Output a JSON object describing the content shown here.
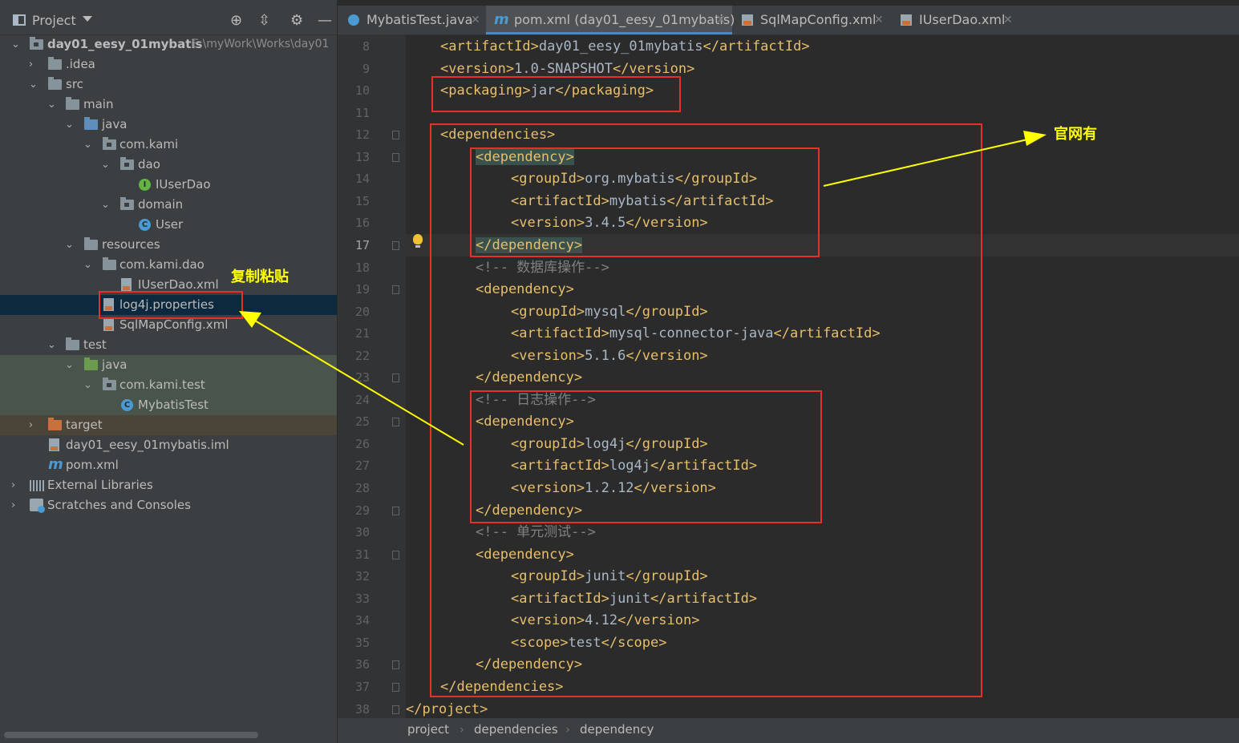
{
  "project_panel": {
    "title": "Project",
    "tree": [
      {
        "label": "day01_eesy_01mybatis",
        "path_hint": "E:\\myWork\\Works\\day01"
      },
      {
        "label": ".idea"
      },
      {
        "label": "src"
      },
      {
        "label": "main"
      },
      {
        "label": "java"
      },
      {
        "label": "com.kami"
      },
      {
        "label": "dao"
      },
      {
        "label": "IUserDao"
      },
      {
        "label": "domain"
      },
      {
        "label": "User"
      },
      {
        "label": "resources"
      },
      {
        "label": "com.kami.dao"
      },
      {
        "label": "IUserDao.xml"
      },
      {
        "label": "log4j.properties"
      },
      {
        "label": "SqlMapConfig.xml"
      },
      {
        "label": "test"
      },
      {
        "label": "java"
      },
      {
        "label": "com.kami.test"
      },
      {
        "label": "MybatisTest"
      },
      {
        "label": "target"
      },
      {
        "label": "day01_eesy_01mybatis.iml"
      },
      {
        "label": "pom.xml"
      },
      {
        "label": "External Libraries"
      },
      {
        "label": "Scratches and Consoles"
      }
    ]
  },
  "tabs": [
    {
      "label": "MybatisTest.java"
    },
    {
      "label": "pom.xml (day01_eesy_01mybatis)"
    },
    {
      "label": "SqlMapConfig.xml"
    },
    {
      "label": "IUserDao.xml"
    }
  ],
  "editor": {
    "line_numbers": [
      "8",
      "9",
      "10",
      "11",
      "12",
      "13",
      "14",
      "15",
      "16",
      "17",
      "18",
      "19",
      "20",
      "21",
      "22",
      "23",
      "24",
      "25",
      "26",
      "27",
      "28",
      "29",
      "30",
      "31",
      "32",
      "33",
      "34",
      "35",
      "36",
      "37",
      "38"
    ],
    "lines": [
      {
        "indent": 1,
        "open": "<artifactId>",
        "value": "day01_eesy_01mybatis",
        "close": "</artifactId>"
      },
      {
        "indent": 1,
        "open": "<version>",
        "value": "1.0-SNAPSHOT",
        "close": "</version>"
      },
      {
        "indent": 1,
        "open": "<packaging>",
        "value": "jar",
        "close": "</packaging>"
      },
      {
        "indent": 0,
        "open": "",
        "value": "",
        "close": ""
      },
      {
        "indent": 1,
        "open": "<dependencies>",
        "value": "",
        "close": ""
      },
      {
        "indent": 2,
        "open": "<dependency>",
        "value": "",
        "close": ""
      },
      {
        "indent": 3,
        "open": "<groupId>",
        "value": "org.mybatis",
        "close": "</groupId>"
      },
      {
        "indent": 3,
        "open": "<artifactId>",
        "value": "mybatis",
        "close": "</artifactId>"
      },
      {
        "indent": 3,
        "open": "<version>",
        "value": "3.4.5",
        "close": "</version>"
      },
      {
        "indent": 2,
        "open": "</dependency>",
        "value": "",
        "close": ""
      },
      {
        "indent": 2,
        "comment": "<!-- 数据库操作-->"
      },
      {
        "indent": 2,
        "open": "<dependency>",
        "value": "",
        "close": ""
      },
      {
        "indent": 3,
        "open": "<groupId>",
        "value": "mysql",
        "close": "</groupId>"
      },
      {
        "indent": 3,
        "open": "<artifactId>",
        "value": "mysql-connector-java",
        "close": "</artifactId>"
      },
      {
        "indent": 3,
        "open": "<version>",
        "value": "5.1.6",
        "close": "</version>"
      },
      {
        "indent": 2,
        "open": "</dependency>",
        "value": "",
        "close": ""
      },
      {
        "indent": 2,
        "comment": "<!-- 日志操作-->"
      },
      {
        "indent": 2,
        "open": "<dependency>",
        "value": "",
        "close": ""
      },
      {
        "indent": 3,
        "open": "<groupId>",
        "value": "log4j",
        "close": "</groupId>"
      },
      {
        "indent": 3,
        "open": "<artifactId>",
        "value": "log4j",
        "close": "</artifactId>"
      },
      {
        "indent": 3,
        "open": "<version>",
        "value": "1.2.12",
        "close": "</version>"
      },
      {
        "indent": 2,
        "open": "</dependency>",
        "value": "",
        "close": ""
      },
      {
        "indent": 2,
        "comment": "<!-- 单元测试-->"
      },
      {
        "indent": 2,
        "open": "<dependency>",
        "value": "",
        "close": ""
      },
      {
        "indent": 3,
        "open": "<groupId>",
        "value": "junit",
        "close": "</groupId>"
      },
      {
        "indent": 3,
        "open": "<artifactId>",
        "value": "junit",
        "close": "</artifactId>"
      },
      {
        "indent": 3,
        "open": "<version>",
        "value": "4.12",
        "close": "</version>"
      },
      {
        "indent": 3,
        "open": "<scope>",
        "value": "test",
        "close": "</scope>"
      },
      {
        "indent": 2,
        "open": "</dependency>",
        "value": "",
        "close": ""
      },
      {
        "indent": 1,
        "open": "</dependencies>",
        "value": "",
        "close": ""
      },
      {
        "indent": 0,
        "open": "</project>",
        "value": "",
        "close": ""
      }
    ]
  },
  "breadcrumb": [
    "project",
    "dependencies",
    "dependency"
  ],
  "annotations": {
    "copy_paste": "复制粘贴",
    "official_site": "官网有"
  },
  "colors": {
    "annotation_box": "#e5312a",
    "annotation_text": "#ffff00",
    "tag": "#e8bf6a",
    "comment": "#808080"
  }
}
